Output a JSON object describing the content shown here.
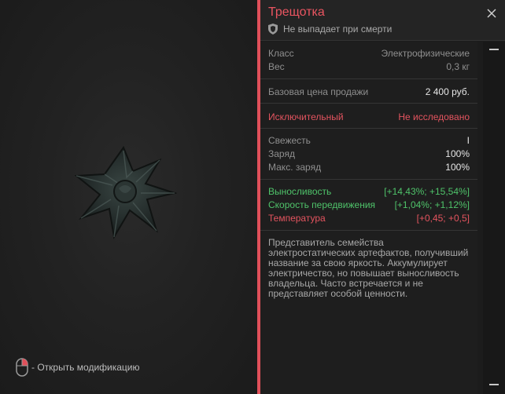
{
  "item": {
    "title": "Трещотка",
    "subtitle": "Не выпадает при смерти"
  },
  "specs": {
    "class_label": "Класс",
    "class_value": "Электрофизические",
    "weight_label": "Вес",
    "weight_value": "0,3 кг"
  },
  "price": {
    "label": "Базовая цена продажи",
    "value": "2 400 руб."
  },
  "rarity": {
    "label": "Исключительный",
    "status": "Не исследовано"
  },
  "state": {
    "freshness_label": "Свежесть",
    "freshness_value": "I",
    "charge_label": "Заряд",
    "charge_value": "100%",
    "max_charge_label": "Макс. заряд",
    "max_charge_value": "100%"
  },
  "effects": [
    {
      "label": "Выносливость",
      "value": "[+14,43%; +15,54%]",
      "color": "#4fc36a"
    },
    {
      "label": "Скорость передвижения",
      "value": "[+1,04%; +1,12%]",
      "color": "#4fc36a"
    },
    {
      "label": "Температура",
      "value": "[+0,45; +0,5]",
      "color": "#e4545f"
    }
  ],
  "description": "Представитель семейства электростатических артефактов, получивший название за свою яркость. Аккумулирует электричество, но повышает выносливость владельца. Часто встречается и не представляет особой ценности.",
  "hint": "- Открыть модификацию",
  "icons": {
    "close": "close-icon",
    "shield": "shield-icon",
    "mouse": "mouse-icon"
  },
  "colors": {
    "accent": "#e0505a",
    "positive": "#4fc36a",
    "negative": "#e4545f"
  }
}
